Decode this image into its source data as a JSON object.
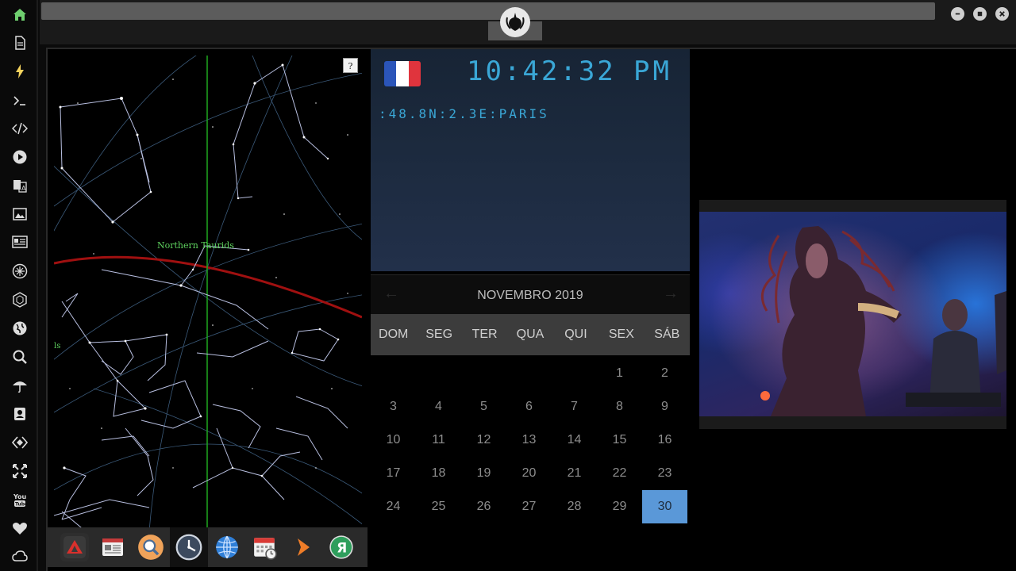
{
  "window": {
    "logo": "rebel-alliance-icon",
    "controls": [
      "minimize",
      "maximize",
      "close"
    ]
  },
  "sidebar": {
    "items": [
      {
        "icon": "home-icon",
        "color": "#6fcf6f"
      },
      {
        "icon": "document-icon"
      },
      {
        "icon": "lightning-icon",
        "color": "#f4d35e"
      },
      {
        "icon": "terminal-icon"
      },
      {
        "icon": "code-icon"
      },
      {
        "icon": "play-icon"
      },
      {
        "icon": "translate-icon"
      },
      {
        "icon": "image-icon"
      },
      {
        "icon": "news-icon"
      },
      {
        "icon": "rebel-icon"
      },
      {
        "icon": "hexagon-icon"
      },
      {
        "icon": "globe-icon"
      },
      {
        "icon": "search-icon"
      },
      {
        "icon": "umbrella-icon"
      },
      {
        "icon": "contact-icon"
      },
      {
        "icon": "transfer-icon"
      },
      {
        "icon": "expand-icon"
      },
      {
        "icon": "youtube-icon"
      },
      {
        "icon": "heart-icon"
      },
      {
        "icon": "cloud-icon"
      }
    ]
  },
  "skymap": {
    "help_label": "?",
    "meteor_label": "Northern Taurids",
    "edge_label": "ls"
  },
  "dock": {
    "items": [
      "red-triangle-app-icon",
      "news-app-icon",
      "search-app-icon",
      "clock-app-icon",
      "globe-app-icon",
      "calendar-app-icon",
      "arrow-app-icon",
      "yandex-app-icon"
    ],
    "active": "clock-app-icon"
  },
  "clock": {
    "time": "10:42:32",
    "ampm": "PM",
    "location": ":48.8N:2.3E:PARIS",
    "flag_colors": [
      "#2b55b9",
      "#ffffff",
      "#e0343d"
    ]
  },
  "calendar": {
    "title": "NOVEMBRO 2019",
    "prev": "←",
    "next": "→",
    "day_names": [
      "DOM",
      "SEG",
      "TER",
      "QUA",
      "QUI",
      "SEX",
      "SÁB"
    ],
    "leading_blanks": 5,
    "days": [
      "1",
      "2",
      "3",
      "4",
      "5",
      "6",
      "7",
      "8",
      "9",
      "10",
      "11",
      "12",
      "13",
      "14",
      "15",
      "16",
      "17",
      "18",
      "19",
      "20",
      "21",
      "22",
      "23",
      "24",
      "25",
      "26",
      "27",
      "28",
      "29",
      "30"
    ],
    "selected": "30",
    "selected_color": "#5a98d8"
  }
}
